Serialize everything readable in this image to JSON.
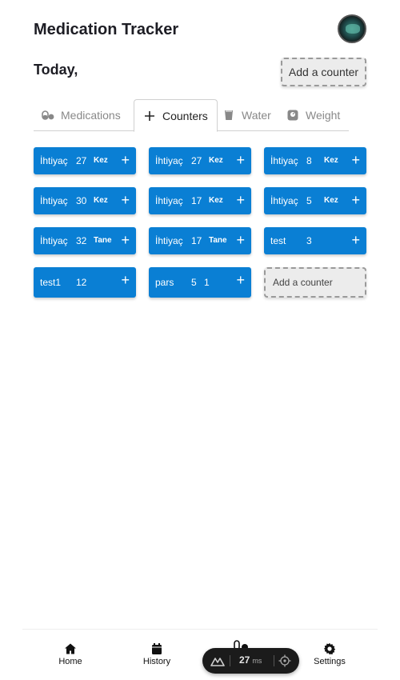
{
  "header": {
    "title": "Medication Tracker"
  },
  "today": {
    "label": "Today,",
    "add_counter_label": "Add a counter"
  },
  "tabs": [
    {
      "label": "Medications",
      "icon": "pill-icon",
      "active": false
    },
    {
      "label": "Counters",
      "icon": "plus-icon",
      "active": true
    },
    {
      "label": "Water",
      "icon": "glass-icon",
      "active": false
    },
    {
      "label": "Weight",
      "icon": "scale-icon",
      "active": false
    }
  ],
  "counters": [
    {
      "name": "İhtiyaç",
      "count": "27",
      "unit": "Kez"
    },
    {
      "name": "İhtiyaç",
      "count": "27",
      "unit": "Kez"
    },
    {
      "name": "İhtiyaç",
      "count": "8",
      "unit": "Kez"
    },
    {
      "name": "İhtiyaç",
      "count": "30",
      "unit": "Kez"
    },
    {
      "name": "İhtiyaç",
      "count": "17",
      "unit": "Kez"
    },
    {
      "name": "İhtiyaç",
      "count": "5",
      "unit": "Kez"
    },
    {
      "name": "İhtiyaç",
      "count": "32",
      "unit": "Tane"
    },
    {
      "name": "İhtiyaç",
      "count": "17",
      "unit": "Tane"
    },
    {
      "name": "test",
      "count": "3",
      "unit": ""
    },
    {
      "name": "test1",
      "count": "12",
      "unit": ""
    },
    {
      "name": "pars",
      "count": "5",
      "unit": "1"
    }
  ],
  "counter_plus": "+",
  "grid_add_counter_label": "Add a counter",
  "bottom_nav": [
    {
      "label": "Home",
      "icon": "home-icon"
    },
    {
      "label": "History",
      "icon": "calendar-icon"
    },
    {
      "label": "Settings",
      "icon": "gear-icon"
    }
  ],
  "devtools": {
    "value": "27",
    "unit": "ms"
  },
  "colors": {
    "counter_bg": "#0a7fd4",
    "text_dark": "#1d1d24",
    "tab_inactive": "#888888"
  }
}
